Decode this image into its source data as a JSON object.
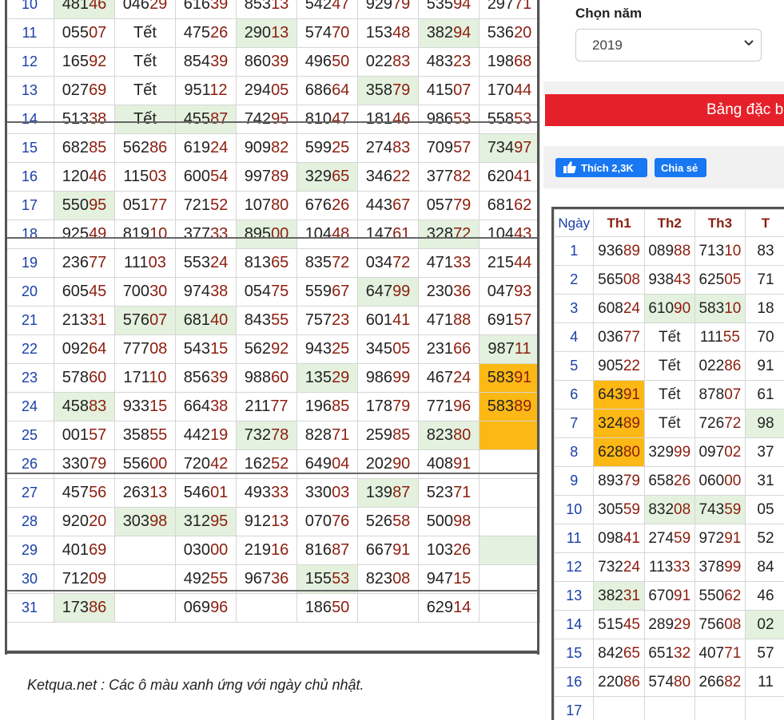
{
  "left_table": {
    "rows": [
      {
        "day": "10",
        "cells": [
          {
            "v": "48146",
            "c": "green"
          },
          {
            "v": "04629"
          },
          {
            "v": "61639"
          },
          {
            "v": "85313"
          },
          {
            "v": "54247"
          },
          {
            "v": "92979"
          },
          {
            "v": "53594"
          },
          {
            "v": "29771"
          }
        ]
      },
      {
        "day": "11",
        "cells": [
          {
            "v": "05507"
          },
          {
            "v": "Tết"
          },
          {
            "v": "47526"
          },
          {
            "v": "29013",
            "c": "green"
          },
          {
            "v": "57470"
          },
          {
            "v": "15348"
          },
          {
            "v": "38294",
            "c": "green"
          },
          {
            "v": "53620"
          }
        ]
      },
      {
        "day": "12",
        "cells": [
          {
            "v": "16592"
          },
          {
            "v": "Tết"
          },
          {
            "v": "85439"
          },
          {
            "v": "86039"
          },
          {
            "v": "49650"
          },
          {
            "v": "02283"
          },
          {
            "v": "48323"
          },
          {
            "v": "19868"
          }
        ]
      },
      {
        "day": "13",
        "cells": [
          {
            "v": "02769"
          },
          {
            "v": "Tết"
          },
          {
            "v": "95112"
          },
          {
            "v": "29405"
          },
          {
            "v": "68664"
          },
          {
            "v": "35879",
            "c": "green"
          },
          {
            "v": "41507"
          },
          {
            "v": "17044"
          }
        ]
      },
      {
        "day": "14",
        "cells": [
          {
            "v": "51338"
          },
          {
            "v": "Tết",
            "c": "green"
          },
          {
            "v": "45587",
            "c": "green"
          },
          {
            "v": "74295"
          },
          {
            "v": "81047"
          },
          {
            "v": "18146"
          },
          {
            "v": "98653"
          },
          {
            "v": "55853"
          }
        ]
      },
      {
        "day": "15",
        "cells": [
          {
            "v": "68285"
          },
          {
            "v": "56286"
          },
          {
            "v": "61924"
          },
          {
            "v": "90982"
          },
          {
            "v": "59925"
          },
          {
            "v": "27483"
          },
          {
            "v": "70957"
          },
          {
            "v": "73497",
            "c": "green"
          }
        ]
      },
      {
        "day": "16",
        "cells": [
          {
            "v": "12046"
          },
          {
            "v": "11503"
          },
          {
            "v": "60054"
          },
          {
            "v": "99789"
          },
          {
            "v": "32965",
            "c": "green"
          },
          {
            "v": "34622"
          },
          {
            "v": "37782"
          },
          {
            "v": "62041"
          }
        ]
      },
      {
        "day": "17",
        "cells": [
          {
            "v": "55095",
            "c": "green"
          },
          {
            "v": "05177"
          },
          {
            "v": "72152"
          },
          {
            "v": "10780"
          },
          {
            "v": "67626"
          },
          {
            "v": "44367"
          },
          {
            "v": "05779"
          },
          {
            "v": "68162"
          }
        ]
      },
      {
        "day": "18",
        "cells": [
          {
            "v": "92549"
          },
          {
            "v": "81910"
          },
          {
            "v": "37733"
          },
          {
            "v": "89500",
            "c": "green"
          },
          {
            "v": "10448"
          },
          {
            "v": "14761"
          },
          {
            "v": "32872",
            "c": "green"
          },
          {
            "v": "10443"
          }
        ]
      },
      {
        "day": "19",
        "cells": [
          {
            "v": "23677"
          },
          {
            "v": "11103"
          },
          {
            "v": "55324"
          },
          {
            "v": "81365"
          },
          {
            "v": "83572"
          },
          {
            "v": "03472"
          },
          {
            "v": "47133"
          },
          {
            "v": "21544"
          }
        ]
      },
      {
        "day": "20",
        "cells": [
          {
            "v": "60545"
          },
          {
            "v": "70030"
          },
          {
            "v": "97438"
          },
          {
            "v": "05475"
          },
          {
            "v": "55967"
          },
          {
            "v": "64799",
            "c": "green"
          },
          {
            "v": "23036"
          },
          {
            "v": "04793"
          }
        ]
      },
      {
        "day": "21",
        "cells": [
          {
            "v": "21331"
          },
          {
            "v": "57607",
            "c": "green"
          },
          {
            "v": "68140",
            "c": "green"
          },
          {
            "v": "84355"
          },
          {
            "v": "75723"
          },
          {
            "v": "60141"
          },
          {
            "v": "47188"
          },
          {
            "v": "69157"
          }
        ]
      },
      {
        "day": "22",
        "cells": [
          {
            "v": "09264"
          },
          {
            "v": "77708"
          },
          {
            "v": "54315"
          },
          {
            "v": "56292"
          },
          {
            "v": "94325"
          },
          {
            "v": "34505"
          },
          {
            "v": "23166"
          },
          {
            "v": "98711",
            "c": "green"
          }
        ]
      },
      {
        "day": "23",
        "cells": [
          {
            "v": "57860"
          },
          {
            "v": "17110"
          },
          {
            "v": "85639"
          },
          {
            "v": "98860"
          },
          {
            "v": "13529",
            "c": "green"
          },
          {
            "v": "98699"
          },
          {
            "v": "46724"
          },
          {
            "v": "58391",
            "c": "orange"
          }
        ]
      },
      {
        "day": "24",
        "cells": [
          {
            "v": "45883",
            "c": "green"
          },
          {
            "v": "93315"
          },
          {
            "v": "66438"
          },
          {
            "v": "21177"
          },
          {
            "v": "19685"
          },
          {
            "v": "17879"
          },
          {
            "v": "77196"
          },
          {
            "v": "58389",
            "c": "orange"
          }
        ]
      },
      {
        "day": "25",
        "cells": [
          {
            "v": "00157"
          },
          {
            "v": "35855"
          },
          {
            "v": "44219"
          },
          {
            "v": "73278",
            "c": "green"
          },
          {
            "v": "82871"
          },
          {
            "v": "25985"
          },
          {
            "v": "82380",
            "c": "green"
          },
          {
            "v": "",
            "c": "orange"
          }
        ]
      },
      {
        "day": "26",
        "cells": [
          {
            "v": "33079"
          },
          {
            "v": "55600"
          },
          {
            "v": "72042"
          },
          {
            "v": "16252"
          },
          {
            "v": "64904"
          },
          {
            "v": "20290"
          },
          {
            "v": "40891"
          },
          {
            "v": ""
          }
        ]
      },
      {
        "day": "27",
        "cells": [
          {
            "v": "45756"
          },
          {
            "v": "26313"
          },
          {
            "v": "54601"
          },
          {
            "v": "49333"
          },
          {
            "v": "33003"
          },
          {
            "v": "13987",
            "c": "green"
          },
          {
            "v": "52371"
          },
          {
            "v": ""
          }
        ]
      },
      {
        "day": "28",
        "cells": [
          {
            "v": "92020"
          },
          {
            "v": "30398",
            "c": "green"
          },
          {
            "v": "31295",
            "c": "green"
          },
          {
            "v": "91213"
          },
          {
            "v": "07076"
          },
          {
            "v": "52658"
          },
          {
            "v": "50098"
          },
          {
            "v": ""
          }
        ]
      },
      {
        "day": "29",
        "cells": [
          {
            "v": "40169"
          },
          {
            "v": ""
          },
          {
            "v": "03000"
          },
          {
            "v": "21916"
          },
          {
            "v": "81687"
          },
          {
            "v": "66791"
          },
          {
            "v": "10326"
          },
          {
            "v": "",
            "c": "green"
          }
        ]
      },
      {
        "day": "30",
        "cells": [
          {
            "v": "71209"
          },
          {
            "v": ""
          },
          {
            "v": "49255"
          },
          {
            "v": "96736"
          },
          {
            "v": "15553",
            "c": "green"
          },
          {
            "v": "82308"
          },
          {
            "v": "94715"
          },
          {
            "v": ""
          }
        ]
      },
      {
        "day": "31",
        "cells": [
          {
            "v": "17386",
            "c": "green"
          },
          {
            "v": ""
          },
          {
            "v": "06996"
          },
          {
            "v": ""
          },
          {
            "v": "18650"
          },
          {
            "v": ""
          },
          {
            "v": "62914"
          },
          {
            "v": ""
          }
        ]
      }
    ]
  },
  "note": "Ketqua.net : Các ô màu xanh ứng với ngày chủ nhật.",
  "year_picker": {
    "label": "Chọn năm",
    "value": "2019"
  },
  "banner": {
    "text": "Bảng đặc b"
  },
  "social": {
    "like_label": "Thích 2,3K",
    "share_label": "Chia sẻ"
  },
  "right_table": {
    "headers": [
      "Ngày",
      "Th1",
      "Th2",
      "Th3",
      "T"
    ],
    "rows": [
      {
        "day": "1",
        "cells": [
          {
            "v": "93689"
          },
          {
            "v": "08988"
          },
          {
            "v": "71310"
          },
          {
            "v": "83"
          }
        ]
      },
      {
        "day": "2",
        "cells": [
          {
            "v": "56508"
          },
          {
            "v": "93843"
          },
          {
            "v": "62505"
          },
          {
            "v": "71"
          }
        ]
      },
      {
        "day": "3",
        "cells": [
          {
            "v": "60824"
          },
          {
            "v": "61090",
            "c": "green"
          },
          {
            "v": "58310",
            "c": "green"
          },
          {
            "v": "18"
          }
        ]
      },
      {
        "day": "4",
        "cells": [
          {
            "v": "03677"
          },
          {
            "v": "Tết"
          },
          {
            "v": "11155"
          },
          {
            "v": "70"
          }
        ]
      },
      {
        "day": "5",
        "cells": [
          {
            "v": "90522"
          },
          {
            "v": "Tết"
          },
          {
            "v": "02286"
          },
          {
            "v": "91"
          }
        ]
      },
      {
        "day": "6",
        "cells": [
          {
            "v": "64391",
            "c": "orange"
          },
          {
            "v": "Tết"
          },
          {
            "v": "87807"
          },
          {
            "v": "61"
          }
        ]
      },
      {
        "day": "7",
        "cells": [
          {
            "v": "32489",
            "c": "orange"
          },
          {
            "v": "Tết"
          },
          {
            "v": "72672"
          },
          {
            "v": "98",
            "c": "green"
          }
        ]
      },
      {
        "day": "8",
        "cells": [
          {
            "v": "62880",
            "c": "orange"
          },
          {
            "v": "32999"
          },
          {
            "v": "09702"
          },
          {
            "v": "37"
          }
        ]
      },
      {
        "day": "9",
        "cells": [
          {
            "v": "89379"
          },
          {
            "v": "65826"
          },
          {
            "v": "06000"
          },
          {
            "v": "31"
          }
        ]
      },
      {
        "day": "10",
        "cells": [
          {
            "v": "30559"
          },
          {
            "v": "83208",
            "c": "green"
          },
          {
            "v": "74359",
            "c": "green"
          },
          {
            "v": "05"
          }
        ]
      },
      {
        "day": "11",
        "cells": [
          {
            "v": "09841"
          },
          {
            "v": "27459"
          },
          {
            "v": "97291"
          },
          {
            "v": "52"
          }
        ]
      },
      {
        "day": "12",
        "cells": [
          {
            "v": "73224"
          },
          {
            "v": "11333"
          },
          {
            "v": "37899"
          },
          {
            "v": "84"
          }
        ]
      },
      {
        "day": "13",
        "cells": [
          {
            "v": "38231",
            "c": "green"
          },
          {
            "v": "67091"
          },
          {
            "v": "55062"
          },
          {
            "v": "46"
          }
        ]
      },
      {
        "day": "14",
        "cells": [
          {
            "v": "51545"
          },
          {
            "v": "28929"
          },
          {
            "v": "75608"
          },
          {
            "v": "02",
            "c": "green"
          }
        ]
      },
      {
        "day": "15",
        "cells": [
          {
            "v": "84265"
          },
          {
            "v": "65132"
          },
          {
            "v": "40771"
          },
          {
            "v": "57"
          }
        ]
      },
      {
        "day": "16",
        "cells": [
          {
            "v": "22086"
          },
          {
            "v": "57480"
          },
          {
            "v": "26682"
          },
          {
            "v": "11"
          }
        ]
      },
      {
        "day": "17",
        "cells": [
          {
            "v": ""
          },
          {
            "v": ""
          },
          {
            "v": ""
          },
          {
            "v": ""
          }
        ]
      }
    ]
  },
  "colors": {
    "green_cell": "#e3f1de",
    "orange_cell": "#fcb814",
    "red_banner": "#e5202a",
    "fb_blue": "#1877f2"
  }
}
